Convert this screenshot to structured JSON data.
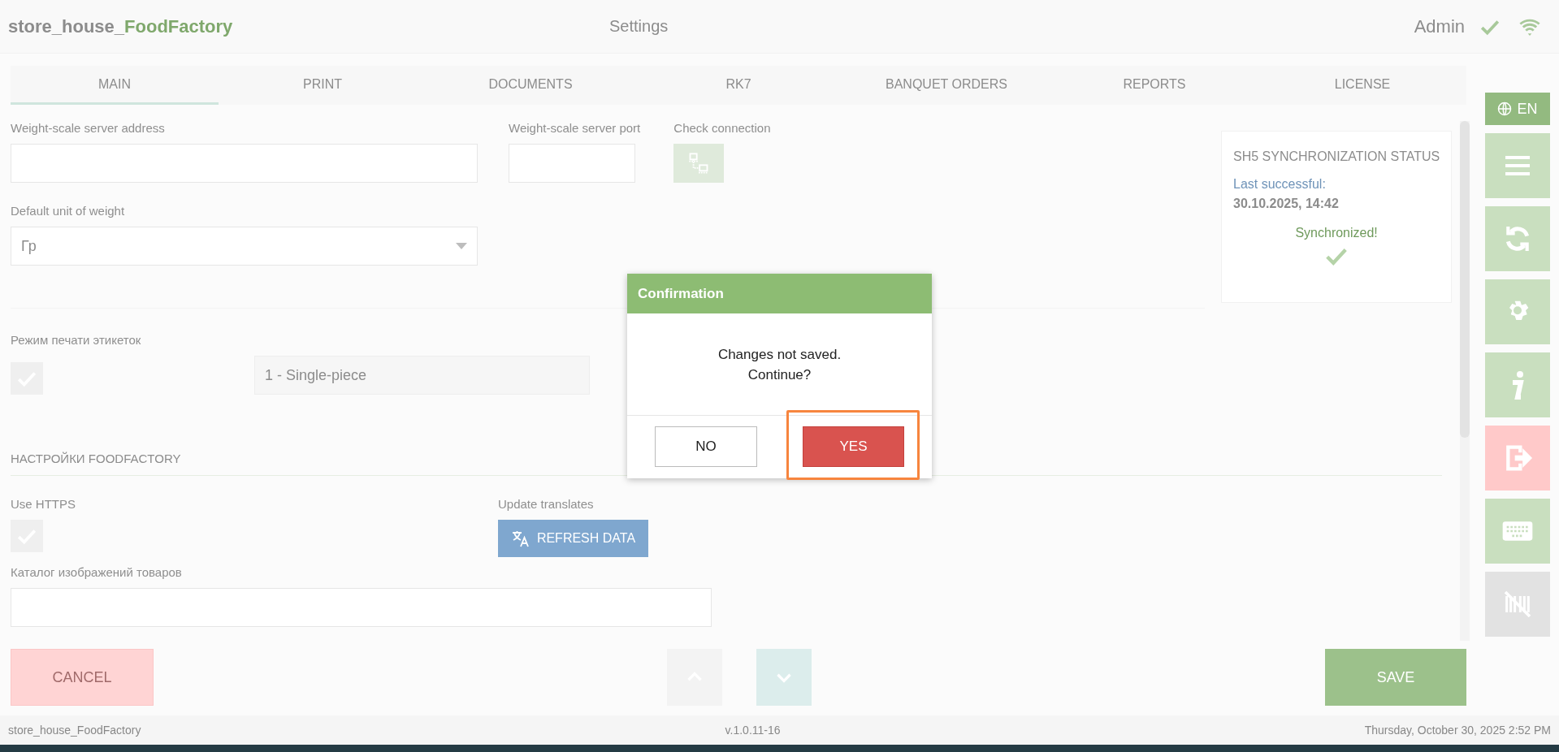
{
  "header": {
    "app_name": "store_house_",
    "app_name_accent": "FoodFactory",
    "page_title": "Settings",
    "user": "Admin"
  },
  "tabs": [
    {
      "label": "MAIN",
      "selected": true
    },
    {
      "label": "PRINT",
      "selected": false
    },
    {
      "label": "DOCUMENTS",
      "selected": false
    },
    {
      "label": "RK7",
      "selected": false
    },
    {
      "label": "BANQUET ORDERS",
      "selected": false
    },
    {
      "label": "REPORTS",
      "selected": false
    },
    {
      "label": "LICENSE",
      "selected": false
    }
  ],
  "form": {
    "scale_address_label": "Weight-scale server address",
    "scale_port_label": "Weight-scale server port",
    "check_connection_label": "Check connection",
    "unit_label": "Default unit of weight",
    "unit_value": "Гр",
    "label_mode_label": "Режим печати этикеток",
    "label_mode_checked": true,
    "label_mode_value": "1 - Single-piece",
    "section_title": "НАСТРОЙКИ FOODFACTORY",
    "https_label": "Use HTTPS",
    "https_checked": true,
    "translates_label": "Update translates",
    "refresh_button": "REFRESH DATA",
    "catalog_label": "Каталог изображений товаров"
  },
  "sync_status": {
    "title": "SH5 SYNCHRONIZATION STATUS",
    "last_label": "Last successful:",
    "last_value": "30.10.2025, 14:42",
    "state": "Synchronized!"
  },
  "sidebar": {
    "language": "EN"
  },
  "bottom_buttons": {
    "cancel": "CANCEL",
    "save": "SAVE"
  },
  "dialog": {
    "title": "Confirmation",
    "message_lines": [
      "Changes not saved.",
      "Continue?"
    ],
    "no": "NO",
    "yes": "YES"
  },
  "status_bar": {
    "app": "store_house_FoodFactory",
    "version": "v.1.0.11-16",
    "datetime": "Thursday, October 30, 2025 2:52 PM"
  }
}
